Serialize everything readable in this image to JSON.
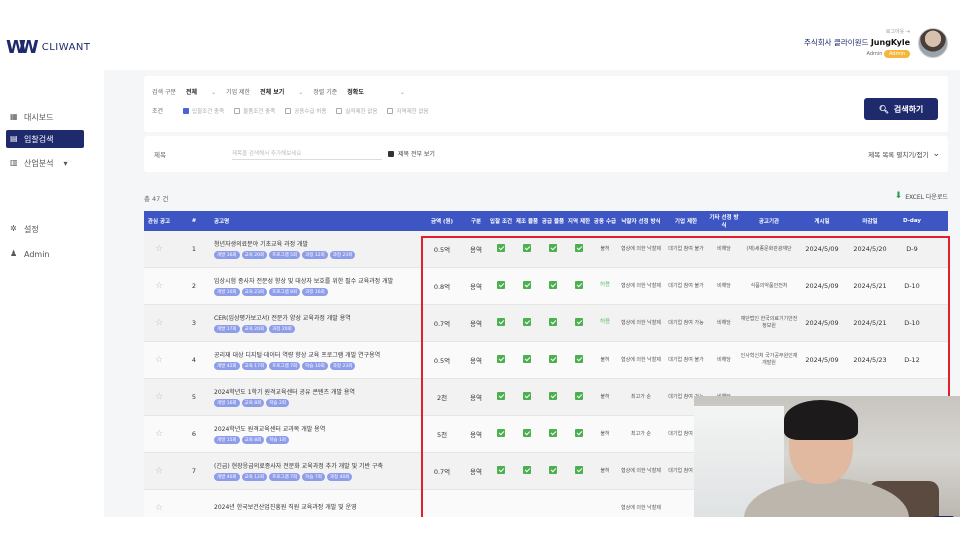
{
  "brand": {
    "logo_mark": "W",
    "logo_text": "CLIWANT"
  },
  "user": {
    "logout": "로그아웃",
    "company": "주식회사 클라이원드",
    "name": "JungKyle",
    "role": "Admin",
    "badge": "Admin"
  },
  "sidebar": {
    "items": [
      {
        "label": "대시보드",
        "icon": "grid-icon"
      },
      {
        "label": "입찰검색",
        "icon": "document-icon",
        "active": true
      },
      {
        "label": "산업분석",
        "icon": "chart-icon"
      },
      {
        "label": "설정",
        "icon": "gear-icon"
      },
      {
        "label": "Admin",
        "icon": "person-icon"
      }
    ]
  },
  "filter": {
    "search_type_label": "검색 구분",
    "search_type_value": "전체",
    "limit_label": "기업 제한",
    "limit_value": "전체 보기",
    "sort_label": "정렬 기준",
    "sort_value": "정확도",
    "cond_label": "조건",
    "conditions": [
      "입찰조건 충족",
      "물품조건 충족",
      "공동수급 허용",
      "실적제한 없음",
      "지역제한 없음"
    ],
    "search_button": "검색하기"
  },
  "search_bar": {
    "label": "제목",
    "placeholder": "제목을 검색해서 추가해보세요",
    "all_label": "제목 전부 보기",
    "toggle": "제목 목록 펼치기/접기"
  },
  "count": "총 47 건",
  "excel": "EXCEL 다운로드",
  "table": {
    "headers": [
      "관심 공고",
      "#",
      "공고명",
      "금액 (원)",
      "구분",
      "입찰 조건",
      "제조 물품",
      "공급 물품",
      "지역 제한",
      "공동 수급",
      "낙찰자 선정 방식",
      "기업 제한",
      "기타 선정 방식",
      "공고기관",
      "게시일",
      "마감일",
      "D-day"
    ],
    "rows": [
      {
        "no": "1",
        "name": "청년자생의료분야 기초교육 과정 개발",
        "tags": [
          "개발 16회",
          "교육 20회",
          "프로그램 5회",
          "과정 12회",
          "과정 23회"
        ],
        "amount": "0.5억",
        "type": "용역",
        "joint": "불허",
        "way": "협상에 의한 낙찰제",
        "limit": "대기업 참여 불가",
        "other": "비해당",
        "agency": "(재)세종문화관광재단",
        "posted": "2024/5/09",
        "deadline": "2024/5/20",
        "dday": "D-9"
      },
      {
        "no": "2",
        "name": "임상시험 종사자 전문성 향상 및 대상자 보호를 위한 필수 교육과정 개발",
        "tags": [
          "개발 10회",
          "교육 23회",
          "프로그램 8회",
          "과정 16회"
        ],
        "amount": "0.8억",
        "type": "용역",
        "joint": "허용",
        "way": "협상에 의한 낙찰제",
        "limit": "대기업 참여 불가",
        "other": "비해당",
        "agency": "식품의약품안전처",
        "posted": "2024/5/09",
        "deadline": "2024/5/21",
        "dday": "D-10"
      },
      {
        "no": "3",
        "name": "CER(임상평가보고서) 전문가 양성 교육과정 개발 용역",
        "tags": [
          "개발 17회",
          "교육 20회",
          "과정 20회"
        ],
        "amount": "0.7억",
        "type": "용역",
        "joint": "허용",
        "way": "협상에 의한 낙찰제",
        "limit": "대기업 참여 가능",
        "other": "비해당",
        "agency": "재단법인 한국의료기기안전정보원",
        "posted": "2024/5/09",
        "deadline": "2024/5/21",
        "dday": "D-10"
      },
      {
        "no": "4",
        "name": "공리재 대상 디지털·데이터 역량 향상 교육 프로그램 개발 연구용역",
        "tags": [
          "개발 42회",
          "교육 17회",
          "프로그램 7회",
          "학습 10회",
          "과정 23회"
        ],
        "amount": "0.5억",
        "type": "용역",
        "joint": "불허",
        "way": "협상에 의한 낙찰제",
        "limit": "대기업 참여 불가",
        "other": "비해당",
        "agency": "인사혁신처 국가공무원인재개발원",
        "posted": "2024/5/09",
        "deadline": "2024/5/23",
        "dday": "D-12"
      },
      {
        "no": "5",
        "name": "2024학년도 1학기 원격교육센터 공유 콘텐츠 개발 용역",
        "tags": [
          "개발 16회",
          "교육 8회",
          "학습 2회"
        ],
        "amount": "2천",
        "type": "용역",
        "joint": "불허",
        "way": "최고가 순",
        "limit": "대기업 참여 가능",
        "other": "비해당",
        "agency": "",
        "posted": "",
        "deadline": "",
        "dday": ""
      },
      {
        "no": "6",
        "name": "2024학년도 원격교육센터 교과목 개발 용역",
        "tags": [
          "개발 15회",
          "교육 8회",
          "학습 1회"
        ],
        "amount": "5천",
        "type": "용역",
        "joint": "불허",
        "way": "최고가 순",
        "limit": "대기업 참여 가능",
        "other": "비해당",
        "agency": "",
        "posted": "",
        "deadline": "",
        "dday": ""
      },
      {
        "no": "7",
        "name": "(긴급) 현장응급의료종사자 전문화 교육과정 추가 개발 및 기반 구축",
        "tags": [
          "개발 40회",
          "교육 12회",
          "프로그램 7회",
          "학습 7회",
          "과정 40회"
        ],
        "amount": "0.7억",
        "type": "용역",
        "joint": "불허",
        "way": "협상에 의한 낙찰제",
        "limit": "대기업 참여 불가",
        "other": "비해당",
        "agency": "",
        "posted": "",
        "deadline": "",
        "dday": ""
      },
      {
        "no": "",
        "name": "2024년 한국보건산업진흥원 직원 교육과정 개발 및 운영",
        "tags": [],
        "amount": "",
        "type": "",
        "joint": "",
        "way": "협상에 의한 낙찰제",
        "limit": "",
        "other": "",
        "agency": "",
        "posted": "",
        "deadline": "",
        "dday": ""
      }
    ]
  },
  "webcam": {
    "logo": "W"
  },
  "colors": {
    "navy": "#1e2a6b",
    "header_blue": "#3d56c4",
    "tag_purple": "#8e9dea",
    "check_green": "#4caf50",
    "highlight_red": "#e0202e"
  }
}
